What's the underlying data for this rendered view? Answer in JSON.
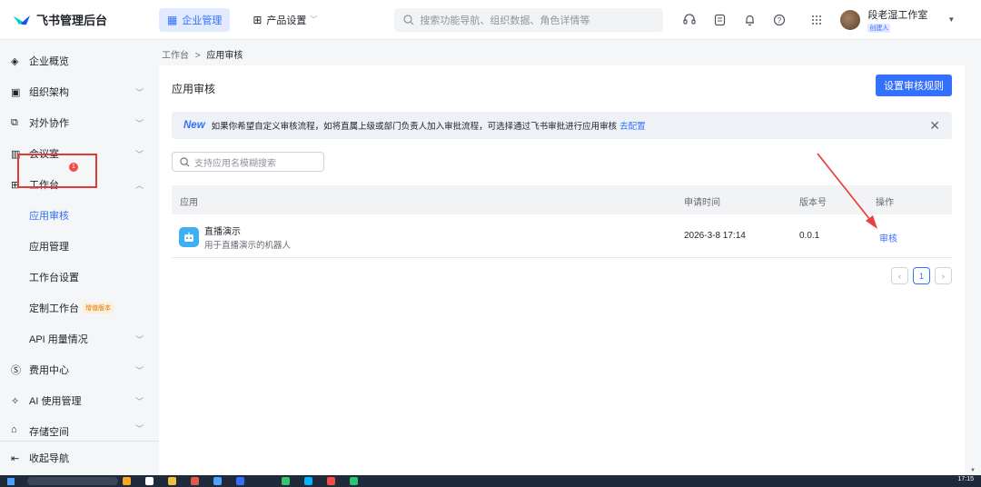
{
  "topbar": {
    "brand": "飞书管理后台",
    "tabs": [
      {
        "label": "企业管理",
        "icon": "building-icon"
      },
      {
        "label": "产品设置",
        "icon": "grid-icon"
      }
    ],
    "search_placeholder": "搜索功能导航、组织数据、角色详情等",
    "user_name": "段老湿工作室",
    "user_badge": "创建人"
  },
  "sidebar": {
    "items": [
      {
        "label": "企业概览",
        "icon": "layers-icon"
      },
      {
        "label": "组织架构",
        "icon": "org-icon"
      },
      {
        "label": "对外协作",
        "icon": "collab-icon"
      },
      {
        "label": "会议室",
        "icon": "meeting-room-icon"
      },
      {
        "label": "工作台",
        "icon": "workbench-icon"
      },
      {
        "label": "应用审核",
        "badge": "1"
      },
      {
        "label": "应用管理"
      },
      {
        "label": "工作台设置"
      },
      {
        "label": "定制工作台",
        "tag": "增值版本"
      },
      {
        "label": "API 用量情况"
      },
      {
        "label": "费用中心",
        "icon": "money-icon"
      },
      {
        "label": "AI 使用管理",
        "icon": "sparkle-icon"
      },
      {
        "label": "存储空间",
        "icon": "storage-icon"
      }
    ],
    "collapse_label": "收起导航"
  },
  "breadcrumb": {
    "parent": "工作台",
    "sep": ">",
    "current": "应用审核"
  },
  "main": {
    "title": "应用审核",
    "primary_button": "设置审核规则",
    "notice": {
      "tag": "New",
      "text": "如果你希望自定义审核流程，如将直属上级或部门负责人加入审批流程，可选择通过飞书审批进行应用审核",
      "link": "去配置"
    },
    "search_placeholder": "支持应用名模糊搜索",
    "table": {
      "headers": [
        "应用",
        "申请时间",
        "版本号",
        "操作"
      ],
      "rows": [
        {
          "name": "直播演示",
          "desc": "用于直播演示的机器人",
          "time": "2026-3-8 17:14",
          "version": "0.0.1",
          "action": "审核"
        }
      ]
    },
    "pagination": {
      "current": "1"
    }
  },
  "colors": {
    "accent": "#3370ff",
    "highlight": "#e03a3a"
  },
  "taskbar": {
    "time": "17:15"
  }
}
